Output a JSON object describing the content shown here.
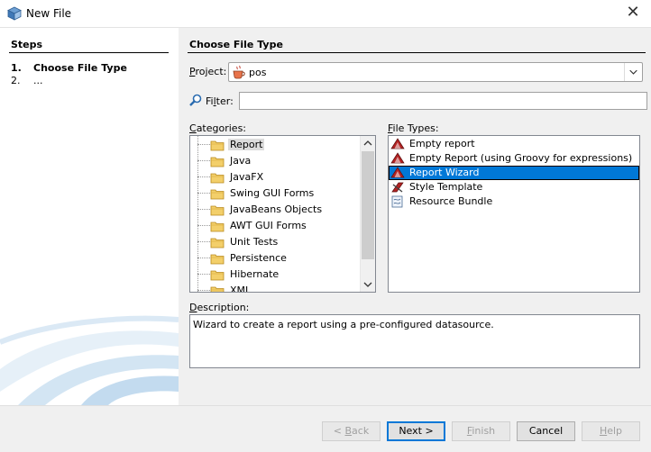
{
  "window": {
    "title": "New File",
    "close_symbol": "✕"
  },
  "steps": {
    "header": "Steps",
    "items": [
      {
        "num": "1.",
        "label": "Choose File Type"
      },
      {
        "num": "2.",
        "label": "..."
      }
    ]
  },
  "main": {
    "header": "Choose File Type",
    "project": {
      "label_prefix": "",
      "label_underlined": "P",
      "label_rest": "roject:",
      "value": "pos",
      "icon": "java-cup-icon"
    },
    "filter": {
      "label_prefix": "Fi",
      "label_underlined": "l",
      "label_rest": "ter:",
      "value": "",
      "icon": "magnifier-icon"
    },
    "categories": {
      "label_prefix": "",
      "label_underlined": "C",
      "label_rest": "ategories:",
      "items": [
        {
          "label": "Report",
          "selected": true
        },
        {
          "label": "Java"
        },
        {
          "label": "JavaFX"
        },
        {
          "label": "Swing GUI Forms"
        },
        {
          "label": "JavaBeans Objects"
        },
        {
          "label": "AWT GUI Forms"
        },
        {
          "label": "Unit Tests"
        },
        {
          "label": "Persistence"
        },
        {
          "label": "Hibernate"
        },
        {
          "label": "XML"
        }
      ]
    },
    "file_types": {
      "label_prefix": "",
      "label_underlined": "F",
      "label_rest": "ile Types:",
      "items": [
        {
          "label": "Empty report",
          "icon": "report-icon"
        },
        {
          "label": "Empty Report (using Groovy for expressions)",
          "icon": "report-icon"
        },
        {
          "label": "Report Wizard",
          "icon": "report-icon",
          "selected": true
        },
        {
          "label": "Style Template",
          "icon": "style-template-icon"
        },
        {
          "label": "Resource Bundle",
          "icon": "resource-bundle-icon"
        }
      ]
    },
    "description": {
      "label_prefix": "",
      "label_underlined": "D",
      "label_rest": "escription:",
      "text": "Wizard to create a report using a pre-configured datasource."
    }
  },
  "buttons": {
    "back": {
      "pre": "< ",
      "u": "B",
      "post": "ack",
      "enabled": false
    },
    "next": {
      "label": "Next >",
      "enabled": true
    },
    "finish": {
      "pre": "",
      "u": "F",
      "post": "inish",
      "enabled": false
    },
    "cancel": {
      "label": "Cancel",
      "enabled": true
    },
    "help": {
      "pre": "",
      "u": "H",
      "post": "elp",
      "enabled": false
    }
  },
  "colors": {
    "selection": "#0078d7",
    "window_bg": "#f0f0f0",
    "report_icon": "#b22222"
  }
}
